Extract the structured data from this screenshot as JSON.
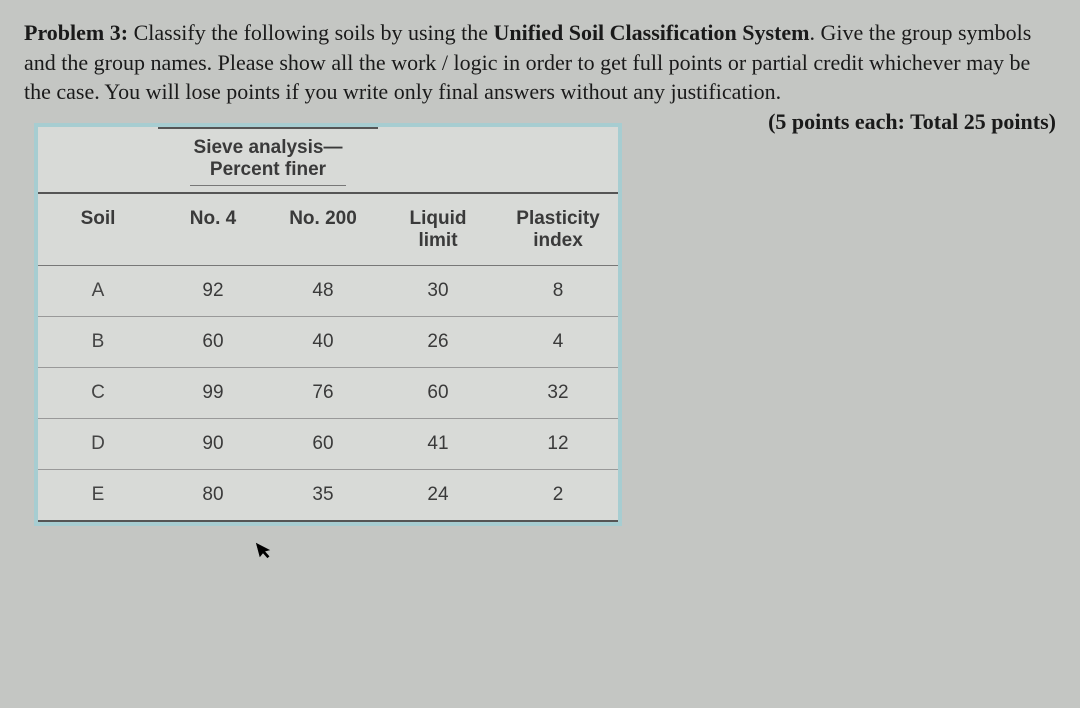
{
  "problem": {
    "label": "Problem 3:",
    "text1": " Classify the following soils by using the ",
    "system": "Unified Soil Classification System",
    "text2": ". Give the group symbols and the group names.  Please show all the work / logic in order to get full points or partial credit whichever may be the case. You will lose points if you write only final answers without any justification.",
    "points": "(5 points each: Total 25 points)"
  },
  "table": {
    "sieve_header_line1": "Sieve analysis—",
    "sieve_header_line2": "Percent finer",
    "col_soil": "Soil",
    "col_no4": "No. 4",
    "col_no200": "No. 200",
    "col_ll_line1": "Liquid",
    "col_ll_line2": "limit",
    "col_pi_line1": "Plasticity",
    "col_pi_line2": "index",
    "rows": [
      {
        "soil": "A",
        "no4": "92",
        "no200": "48",
        "ll": "30",
        "pi": "8"
      },
      {
        "soil": "B",
        "no4": "60",
        "no200": "40",
        "ll": "26",
        "pi": "4"
      },
      {
        "soil": "C",
        "no4": "99",
        "no200": "76",
        "ll": "60",
        "pi": "32"
      },
      {
        "soil": "D",
        "no4": "90",
        "no200": "60",
        "ll": "41",
        "pi": "12"
      },
      {
        "soil": "E",
        "no4": "80",
        "no200": "35",
        "ll": "24",
        "pi": "2"
      }
    ]
  },
  "chart_data": {
    "type": "table",
    "title": "Soil classification data — Unified Soil Classification System",
    "columns": [
      "Soil",
      "Sieve No. 4 % finer",
      "Sieve No. 200 % finer",
      "Liquid limit",
      "Plasticity index"
    ],
    "rows": [
      [
        "A",
        92,
        48,
        30,
        8
      ],
      [
        "B",
        60,
        40,
        26,
        4
      ],
      [
        "C",
        99,
        76,
        60,
        32
      ],
      [
        "D",
        90,
        60,
        41,
        12
      ],
      [
        "E",
        80,
        35,
        24,
        2
      ]
    ]
  }
}
